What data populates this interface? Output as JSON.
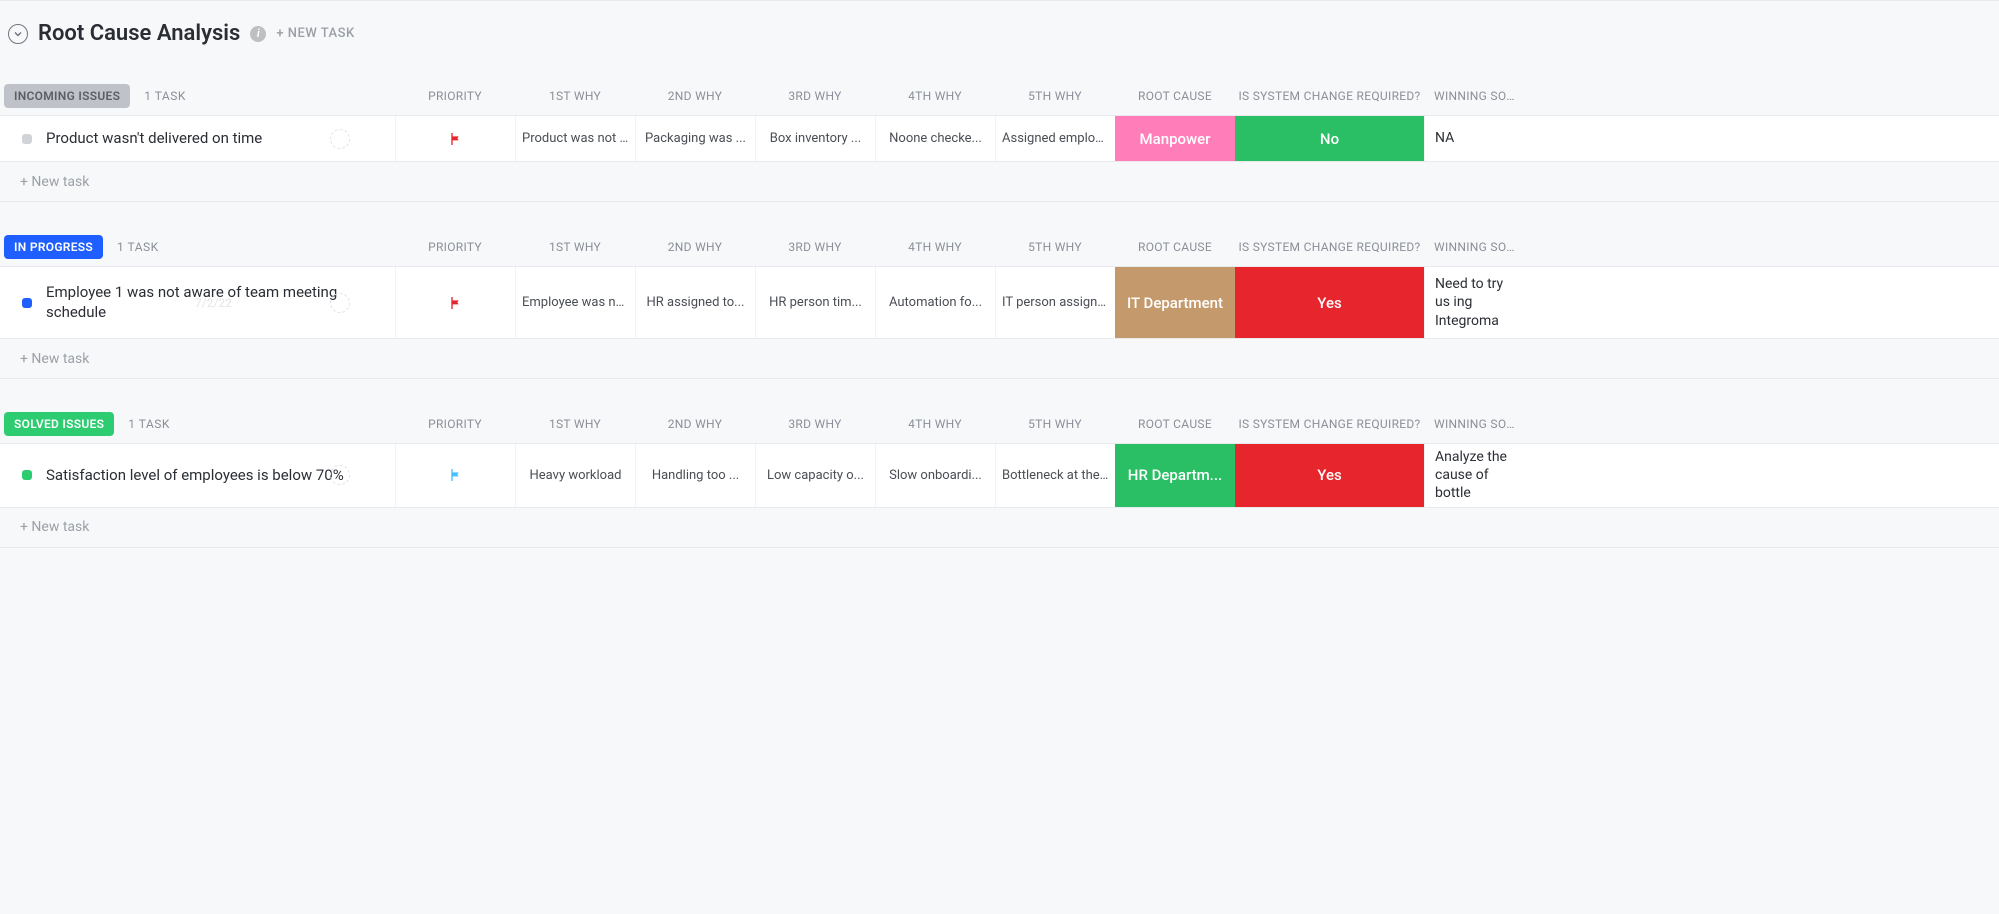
{
  "header": {
    "title": "Root Cause Analysis",
    "newTaskLabel": "+ NEW TASK"
  },
  "columns": {
    "priority": "PRIORITY",
    "why1": "1ST WHY",
    "why2": "2ND WHY",
    "why3": "3RD WHY",
    "why4": "4TH WHY",
    "why5": "5TH WHY",
    "rootCause": "ROOT CAUSE",
    "systemChange": "IS SYSTEM CHANGE REQUIRED?",
    "winning": "WINNING SOLUT"
  },
  "newTaskRow": "+ New task",
  "groups": [
    {
      "name": "INCOMING ISSUES",
      "pillClass": "pill-grey",
      "count": "1 TASK",
      "rows": [
        {
          "dotClass": "dot-grey",
          "name": "Product wasn't delivered on time",
          "ghostDate": "",
          "flag": "red",
          "rowClass": "",
          "why1": "Product was not rea...",
          "why2": "Packaging was ...",
          "why3": "Box inventory ...",
          "why4": "Noone checke...",
          "why5": "Assigned employ...",
          "rootCause": "Manpower",
          "rootCauseBg": "bg-pink",
          "systemChange": "No",
          "systemChangeBg": "bg-green",
          "winning": "NA"
        }
      ]
    },
    {
      "name": "IN PROGRESS",
      "pillClass": "pill-blue",
      "count": "1 TASK",
      "rows": [
        {
          "dotClass": "dot-blue",
          "name": "Employee 1 was not aware of team meeting schedule",
          "ghostDate": "7/2/22",
          "flag": "red",
          "rowClass": "tall",
          "why1": "Employee was not b...",
          "why2": "HR assigned to...",
          "why3": "HR person tim...",
          "why4": "Automation fo...",
          "why5": "IT person assigne...",
          "rootCause": "IT Department",
          "rootCauseBg": "bg-tan",
          "systemChange": "Yes",
          "systemChangeBg": "bg-red",
          "winning": "Need to try us ing Integroma"
        }
      ]
    },
    {
      "name": "SOLVED ISSUES",
      "pillClass": "pill-green",
      "count": "1 TASK",
      "rows": [
        {
          "dotClass": "dot-green",
          "name": "Satisfaction level of employees is below 70%",
          "ghostDate": "",
          "flag": "blue",
          "rowClass": "med",
          "why1": "Heavy workload",
          "why2": "Handling too ...",
          "why3": "Low capacity o...",
          "why4": "Slow onboardi...",
          "why5": "Bottleneck at the...",
          "rootCause": "HR Departm...",
          "rootCauseBg": "bg-green",
          "systemChange": "Yes",
          "systemChangeBg": "bg-red",
          "winning": "Analyze the cause of bottle"
        }
      ]
    }
  ]
}
